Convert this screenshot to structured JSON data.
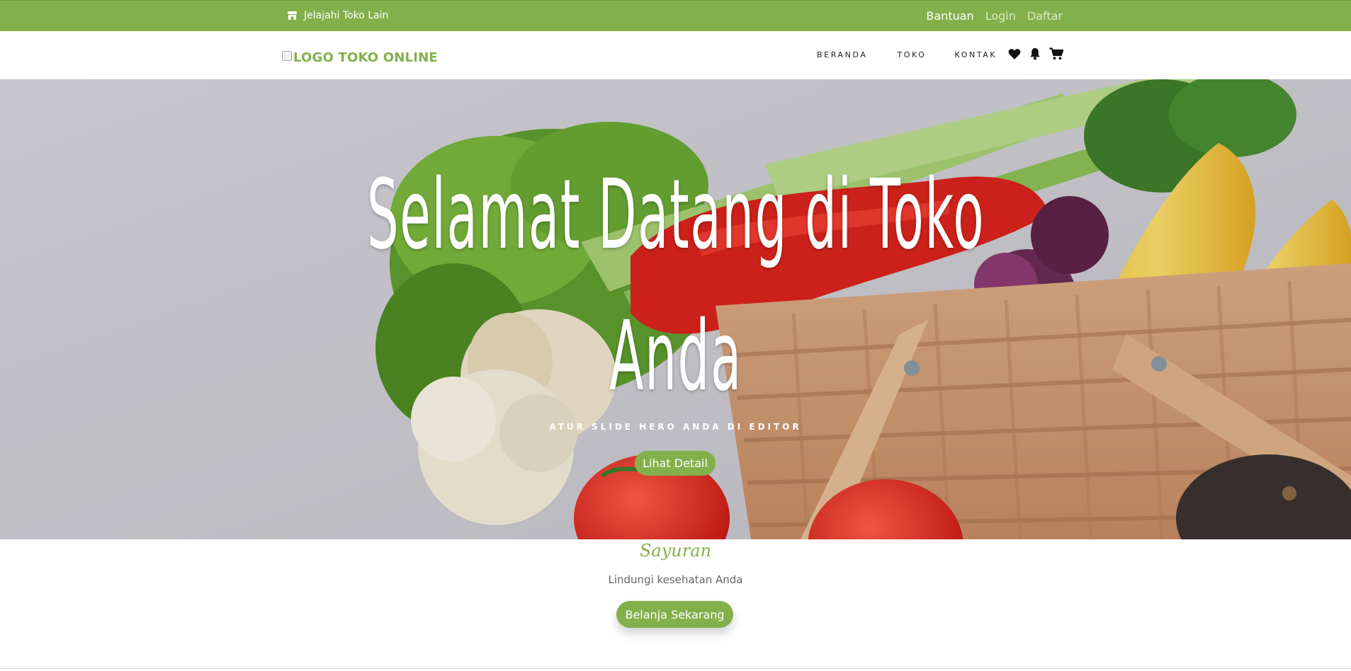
{
  "topbar": {
    "explore_label": "Jelajahi Toko Lain",
    "explore_icon": "store-icon",
    "links": {
      "help": "Bantuan",
      "login": "Login",
      "register": "Daftar"
    },
    "background": "#82b04a"
  },
  "header": {
    "logo_alt": "LOGO TOKO ONLINE",
    "nav": [
      "BERANDA",
      "TOKO",
      "KONTAK"
    ],
    "icons": [
      "heart-icon",
      "bell-icon",
      "cart-icon"
    ]
  },
  "hero": {
    "title": "Selamat Datang di Toko Anda",
    "subtitle": "ATUR SLIDE HERO ANDA DI EDITOR",
    "button_label": "Lihat Detail"
  },
  "category": {
    "name": "Sayuran",
    "description": "Lindungi kesehatan Anda",
    "button_label": "Belanja Sekarang"
  },
  "colors": {
    "accent": "#82b04a",
    "text_dark": "#222222",
    "text_muted": "#666666"
  }
}
